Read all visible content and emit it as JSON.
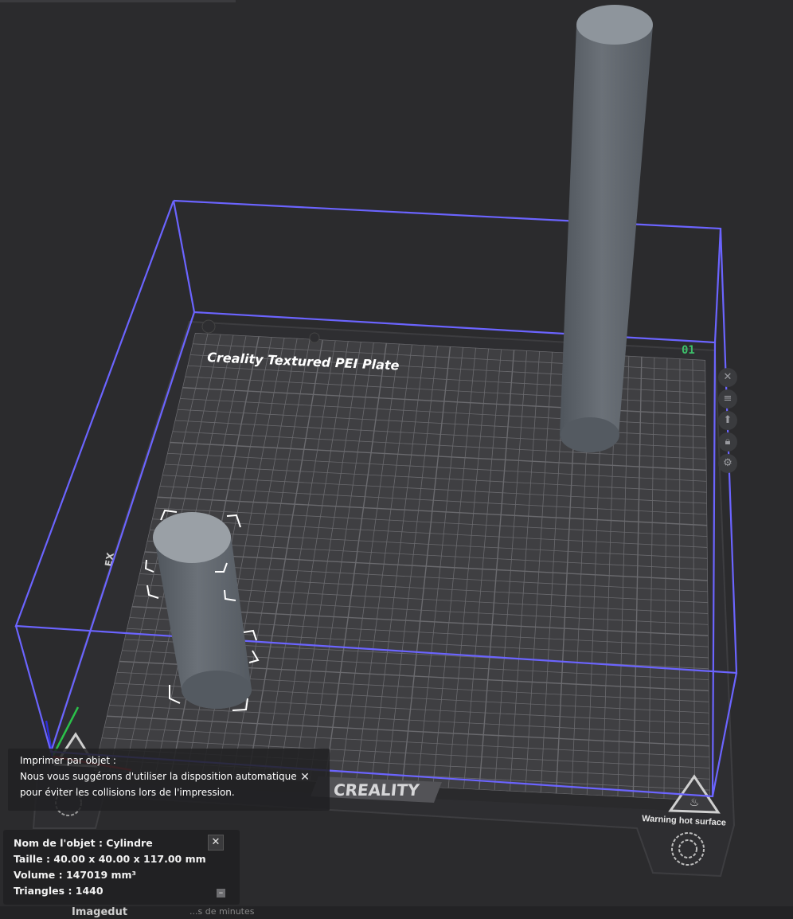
{
  "plate": {
    "title": "Creality Textured PEI Plate",
    "number": "01",
    "brand_logo": "CREALITY",
    "warning_right": "Warning hot surface",
    "warning_left": "Warning hot surface"
  },
  "plate_toolbar": {
    "icons": [
      "close-icon",
      "list-icon",
      "arrange-icon",
      "lock-icon",
      "settings-icon"
    ]
  },
  "toast": {
    "line1": "Imprimer par objet :",
    "line2": "Nous vous suggérons d'utiliser la disposition automatique",
    "line3": "pour éviter les collisions lors de l'impression.",
    "close": "✕"
  },
  "object_info": {
    "name": "Nom de l'objet : Cylindre",
    "size": "Taille : 40.00 x 40.00 x 117.00 mm",
    "volume": "Volume : 147019 mm³",
    "triangles": "Triangles : 1440",
    "close": "✕",
    "collapse": "–"
  },
  "footer": {
    "left": "Imagedut",
    "right": "...s de minutes"
  },
  "colors": {
    "background": "#2b2b2d",
    "plate": "#3f3f42",
    "grid": "#6a6a6e",
    "volume_outline": "#6b64ff",
    "object": "#6b7178",
    "plate_number": "#3dbf6a"
  }
}
